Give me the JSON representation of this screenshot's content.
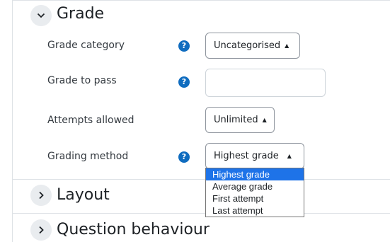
{
  "sections": {
    "grade": {
      "title": "Grade"
    },
    "layout": {
      "title": "Layout"
    },
    "question_behaviour": {
      "title": "Question behaviour"
    }
  },
  "fields": {
    "grade_category": {
      "label": "Grade category",
      "value": "Uncategorised"
    },
    "grade_to_pass": {
      "label": "Grade to pass",
      "value": ""
    },
    "attempts_allowed": {
      "label": "Attempts allowed",
      "value": "Unlimited"
    },
    "grading_method": {
      "label": "Grading method",
      "value": "Highest grade"
    }
  },
  "grading_options": [
    "Highest grade",
    "Average grade",
    "First attempt",
    "Last attempt"
  ],
  "help_glyph": "?",
  "colors": {
    "accent": "#0f6cbf",
    "selection": "#1e73e8"
  }
}
